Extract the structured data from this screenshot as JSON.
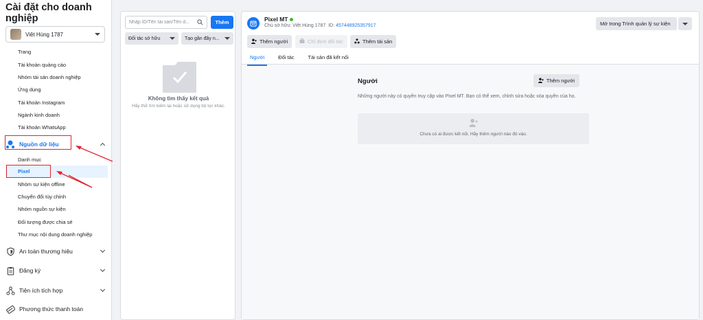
{
  "sidebar": {
    "title": "Cài đặt cho doanh nghiệp",
    "account": "Việt Hùng 1787",
    "items_top": [
      "Trang",
      "Tài khoản quảng cáo",
      "Nhóm tài sản doanh nghiệp",
      "Ứng dụng",
      "Tài khoản Instagram",
      "Ngành kinh doanh",
      "Tài khoản WhatsApp"
    ],
    "data_sources_label": "Nguồn dữ liệu",
    "data_sources_items": [
      "Danh mục",
      "Pixel",
      "Nhóm sự kiện offline",
      "Chuyển đổi tùy chỉnh",
      "Nhóm nguồn sự kiện",
      "Đối tượng được chia sẻ",
      "Thư mục nội dung doanh nghiệp"
    ],
    "sections": [
      "An toàn thương hiệu",
      "Đăng ký",
      "Tiện ích tích hợp",
      "Phương thức thanh toán"
    ]
  },
  "middle": {
    "search_placeholder": "Nhập ID/Tên tài sản/Tên d...",
    "add_button": "Thêm",
    "filter_owner": "Đối tác sở hữu",
    "filter_created": "Tạo gần đây n...",
    "empty_title": "Không tìm thấy kết quả",
    "empty_desc": "Hãy thử tìm kiếm lại hoặc sử dụng bộ lọc khác."
  },
  "pixel": {
    "name": "Pixel MT",
    "owner": "Chủ sở hữu: Việt Hùng 1787",
    "id_label": "ID:",
    "id": "457448925357917",
    "btn_add_people": "Thêm người",
    "btn_assign_partner": "Chỉ định đối tác",
    "btn_add_assets": "Thêm tài sản",
    "btn_open_events_manager": "Mở trong Trình quản lý sự kiện",
    "tabs": [
      "Người",
      "Đối tác",
      "Tài sản đã kết nối"
    ],
    "people_title": "Người",
    "people_add_button": "Thêm người",
    "people_desc": "Những người này có quyền truy cập vào Pixel MT. Bạn có thể xem, chỉnh sửa hoặc xóa quyền của họ.",
    "people_empty": "Chưa có ai được kết nối. Hãy thêm người nào đó vào."
  },
  "colors": {
    "accent": "#1877f2",
    "highlight_box": "#e0252f",
    "active_bg": "#e7f3ff"
  }
}
